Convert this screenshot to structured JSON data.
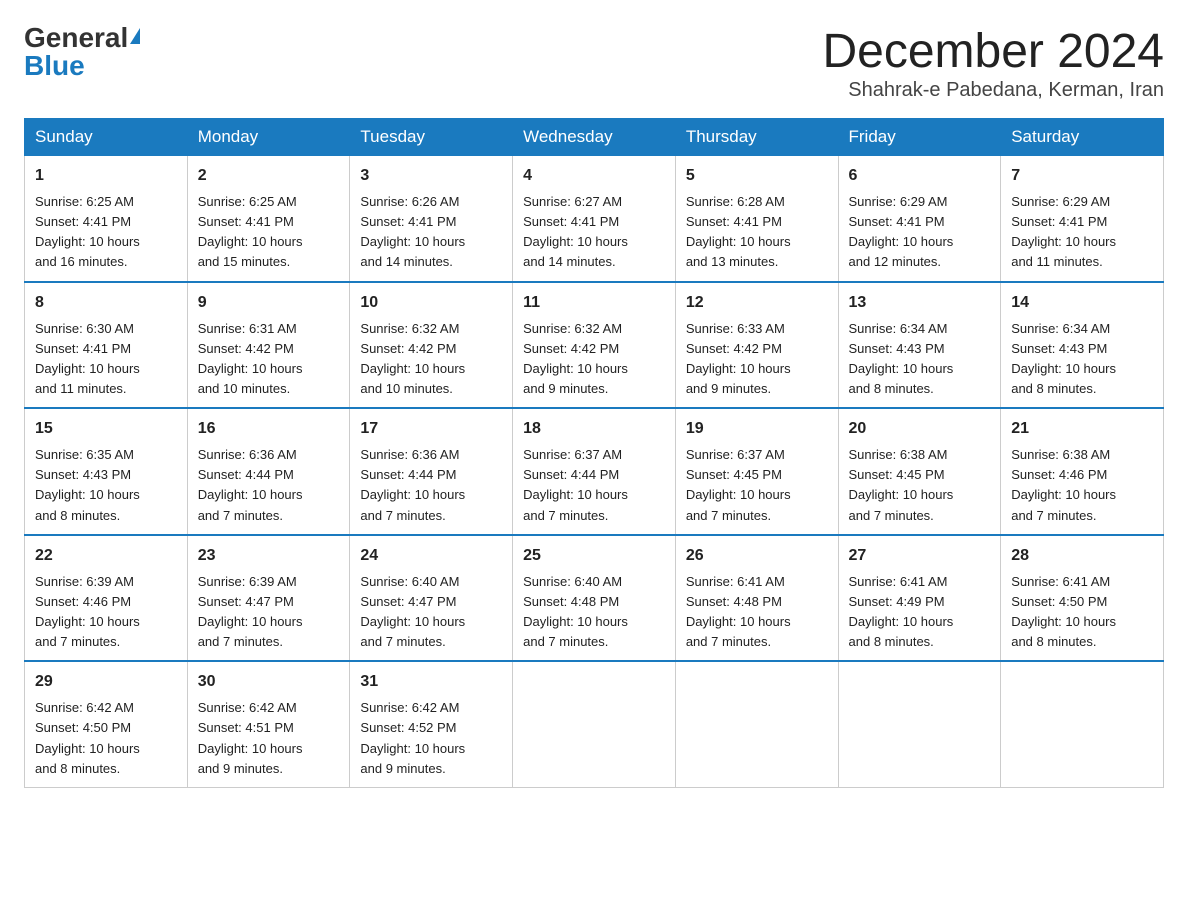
{
  "header": {
    "logo_general": "General",
    "logo_blue": "Blue",
    "month_title": "December 2024",
    "location": "Shahrak-e Pabedana, Kerman, Iran"
  },
  "columns": [
    "Sunday",
    "Monday",
    "Tuesday",
    "Wednesday",
    "Thursday",
    "Friday",
    "Saturday"
  ],
  "weeks": [
    [
      {
        "day": "1",
        "sunrise": "6:25 AM",
        "sunset": "4:41 PM",
        "daylight": "10 hours and 16 minutes."
      },
      {
        "day": "2",
        "sunrise": "6:25 AM",
        "sunset": "4:41 PM",
        "daylight": "10 hours and 15 minutes."
      },
      {
        "day": "3",
        "sunrise": "6:26 AM",
        "sunset": "4:41 PM",
        "daylight": "10 hours and 14 minutes."
      },
      {
        "day": "4",
        "sunrise": "6:27 AM",
        "sunset": "4:41 PM",
        "daylight": "10 hours and 14 minutes."
      },
      {
        "day": "5",
        "sunrise": "6:28 AM",
        "sunset": "4:41 PM",
        "daylight": "10 hours and 13 minutes."
      },
      {
        "day": "6",
        "sunrise": "6:29 AM",
        "sunset": "4:41 PM",
        "daylight": "10 hours and 12 minutes."
      },
      {
        "day": "7",
        "sunrise": "6:29 AM",
        "sunset": "4:41 PM",
        "daylight": "10 hours and 11 minutes."
      }
    ],
    [
      {
        "day": "8",
        "sunrise": "6:30 AM",
        "sunset": "4:41 PM",
        "daylight": "10 hours and 11 minutes."
      },
      {
        "day": "9",
        "sunrise": "6:31 AM",
        "sunset": "4:42 PM",
        "daylight": "10 hours and 10 minutes."
      },
      {
        "day": "10",
        "sunrise": "6:32 AM",
        "sunset": "4:42 PM",
        "daylight": "10 hours and 10 minutes."
      },
      {
        "day": "11",
        "sunrise": "6:32 AM",
        "sunset": "4:42 PM",
        "daylight": "10 hours and 9 minutes."
      },
      {
        "day": "12",
        "sunrise": "6:33 AM",
        "sunset": "4:42 PM",
        "daylight": "10 hours and 9 minutes."
      },
      {
        "day": "13",
        "sunrise": "6:34 AM",
        "sunset": "4:43 PM",
        "daylight": "10 hours and 8 minutes."
      },
      {
        "day": "14",
        "sunrise": "6:34 AM",
        "sunset": "4:43 PM",
        "daylight": "10 hours and 8 minutes."
      }
    ],
    [
      {
        "day": "15",
        "sunrise": "6:35 AM",
        "sunset": "4:43 PM",
        "daylight": "10 hours and 8 minutes."
      },
      {
        "day": "16",
        "sunrise": "6:36 AM",
        "sunset": "4:44 PM",
        "daylight": "10 hours and 7 minutes."
      },
      {
        "day": "17",
        "sunrise": "6:36 AM",
        "sunset": "4:44 PM",
        "daylight": "10 hours and 7 minutes."
      },
      {
        "day": "18",
        "sunrise": "6:37 AM",
        "sunset": "4:44 PM",
        "daylight": "10 hours and 7 minutes."
      },
      {
        "day": "19",
        "sunrise": "6:37 AM",
        "sunset": "4:45 PM",
        "daylight": "10 hours and 7 minutes."
      },
      {
        "day": "20",
        "sunrise": "6:38 AM",
        "sunset": "4:45 PM",
        "daylight": "10 hours and 7 minutes."
      },
      {
        "day": "21",
        "sunrise": "6:38 AM",
        "sunset": "4:46 PM",
        "daylight": "10 hours and 7 minutes."
      }
    ],
    [
      {
        "day": "22",
        "sunrise": "6:39 AM",
        "sunset": "4:46 PM",
        "daylight": "10 hours and 7 minutes."
      },
      {
        "day": "23",
        "sunrise": "6:39 AM",
        "sunset": "4:47 PM",
        "daylight": "10 hours and 7 minutes."
      },
      {
        "day": "24",
        "sunrise": "6:40 AM",
        "sunset": "4:47 PM",
        "daylight": "10 hours and 7 minutes."
      },
      {
        "day": "25",
        "sunrise": "6:40 AM",
        "sunset": "4:48 PM",
        "daylight": "10 hours and 7 minutes."
      },
      {
        "day": "26",
        "sunrise": "6:41 AM",
        "sunset": "4:48 PM",
        "daylight": "10 hours and 7 minutes."
      },
      {
        "day": "27",
        "sunrise": "6:41 AM",
        "sunset": "4:49 PM",
        "daylight": "10 hours and 8 minutes."
      },
      {
        "day": "28",
        "sunrise": "6:41 AM",
        "sunset": "4:50 PM",
        "daylight": "10 hours and 8 minutes."
      }
    ],
    [
      {
        "day": "29",
        "sunrise": "6:42 AM",
        "sunset": "4:50 PM",
        "daylight": "10 hours and 8 minutes."
      },
      {
        "day": "30",
        "sunrise": "6:42 AM",
        "sunset": "4:51 PM",
        "daylight": "10 hours and 9 minutes."
      },
      {
        "day": "31",
        "sunrise": "6:42 AM",
        "sunset": "4:52 PM",
        "daylight": "10 hours and 9 minutes."
      },
      null,
      null,
      null,
      null
    ]
  ],
  "labels": {
    "sunrise": "Sunrise:",
    "sunset": "Sunset:",
    "daylight": "Daylight:"
  }
}
